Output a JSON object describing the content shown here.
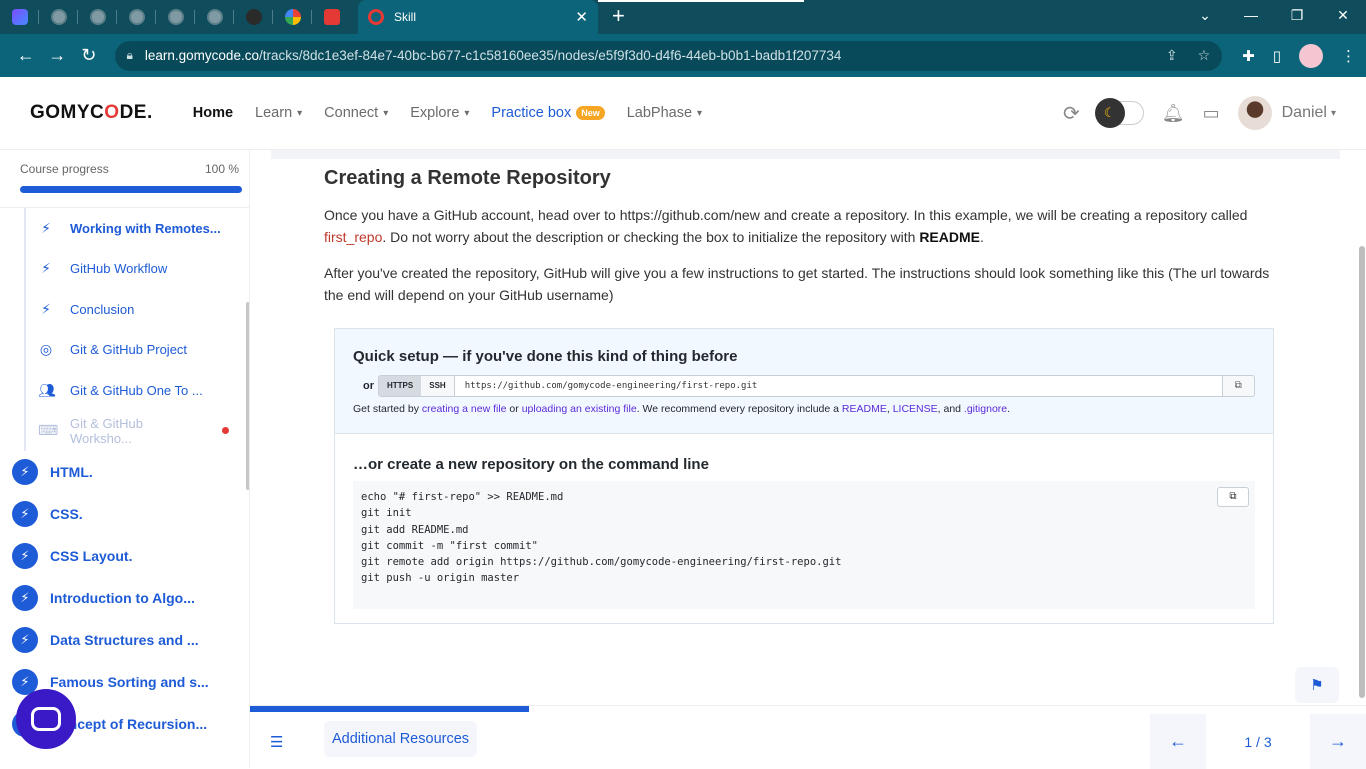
{
  "browser": {
    "active_tab": {
      "title": "Skill"
    },
    "address": {
      "host": "learn.gomycode.co",
      "path": "/tracks/8dc1e3ef-84e7-40bc-b677-c1c58160ee35/nodes/e5f9f3d0-d4f6-44eb-b0b1-badb1f207734"
    }
  },
  "header": {
    "logo": {
      "pre": "GOMYC",
      "o": "O",
      "post": "DE."
    },
    "nav": [
      {
        "label": "Home"
      },
      {
        "label": "Learn"
      },
      {
        "label": "Connect"
      },
      {
        "label": "Explore"
      },
      {
        "label": "Practice box",
        "badge": "New"
      },
      {
        "label": "LabPhase"
      }
    ],
    "user": {
      "name": "Daniel"
    }
  },
  "sidebar": {
    "progress_label": "Course progress",
    "progress_value": "100 %",
    "progress_fraction": 1.0,
    "subitems": [
      {
        "label": "Working with Remotes...",
        "icon": "lightning-icon",
        "state": "active"
      },
      {
        "label": "GitHub Workflow",
        "icon": "lightning-icon",
        "state": "normal"
      },
      {
        "label": "Conclusion",
        "icon": "lightning-icon",
        "state": "normal"
      },
      {
        "label": "Git & GitHub Project",
        "icon": "target-icon",
        "state": "normal"
      },
      {
        "label": "Git & GitHub One To ...",
        "icon": "people-icon",
        "state": "normal"
      },
      {
        "label": "Git & GitHub Worksho...",
        "icon": "workshop-icon",
        "state": "disabled"
      }
    ],
    "chapters": [
      {
        "label": "HTML."
      },
      {
        "label": "CSS."
      },
      {
        "label": "CSS Layout."
      },
      {
        "label": "Introduction to Algo..."
      },
      {
        "label": "Data Structures and ..."
      },
      {
        "label": "Famous Sorting and s..."
      },
      {
        "label": "Concept of Recursion..."
      }
    ]
  },
  "content": {
    "title": "Creating a Remote Repository",
    "p1_a": "Once you have a GitHub account, head over to https://github.com/new and create a repository. In this example, we will be creating a repository called ",
    "p1_code": "first_repo",
    "p1_b": ". Do not worry about the description or checking the box to initialize the repository with ",
    "p1_bold": "README",
    "p1_c": ".",
    "p2": "After you've created the repository, GitHub will give you a few instructions to get started. The instructions should look something like this (The url towards the end will depend on your GitHub username)",
    "github": {
      "quick_title": "Quick setup — if you've done this kind of thing before",
      "or": "or",
      "https": "HTTPS",
      "ssh": "SSH",
      "url": "https://github.com/gomycode-engineering/first-repo.git",
      "hint_1": "Get started by ",
      "link_new": "creating a new file",
      "hint_2": " or ",
      "link_upload": "uploading an existing file",
      "hint_3": ". We recommend every repository include a ",
      "link_readme": "README",
      "hint_4": ", ",
      "link_license": "LICENSE",
      "hint_5": ", and ",
      "link_gitignore": ".gitignore",
      "hint_6": ".",
      "cli_title": "…or create a new repository on the command line",
      "code": [
        "echo \"# first-repo\" >> README.md",
        "git init",
        "git add README.md",
        "git commit -m \"first commit\"",
        "git remote add origin https://github.com/gomycode-engineering/first-repo.git",
        "git push -u origin master"
      ]
    }
  },
  "bottom": {
    "tab_label": "Additional Resources",
    "page": "1 / 3",
    "progress_fraction": 0.333
  },
  "colors": {
    "primary": "#1e5bd6",
    "accent": "#e53935",
    "chrome": "#0b6479"
  }
}
